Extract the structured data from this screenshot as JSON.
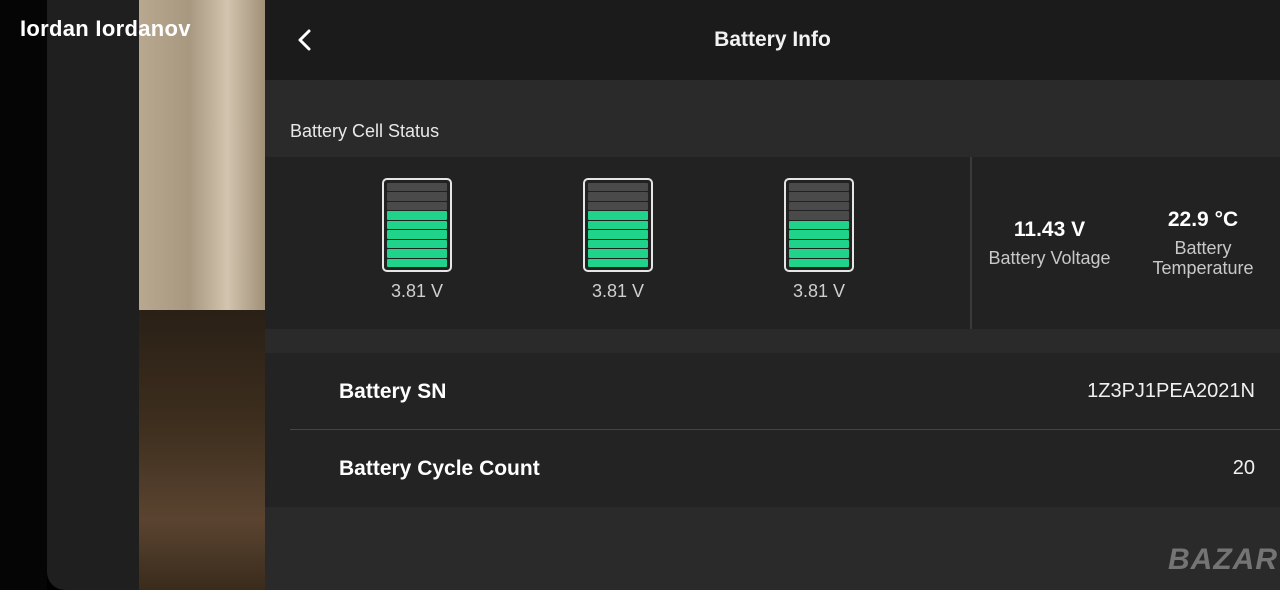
{
  "owner": {
    "name": "Iordan Iordanov"
  },
  "header": {
    "title": "Battery Info"
  },
  "cells": {
    "section_label": "Battery Cell Status",
    "items": [
      {
        "voltage": "3.81 V",
        "level_bars": 6,
        "total_bars": 9
      },
      {
        "voltage": "3.81 V",
        "level_bars": 6,
        "total_bars": 9
      },
      {
        "voltage": "3.81 V",
        "level_bars": 5,
        "total_bars": 9
      }
    ]
  },
  "stats": {
    "voltage": {
      "value": "11.43 V",
      "label": "Battery Voltage"
    },
    "temperature": {
      "value": "22.9 °C",
      "label": "Battery Temperature"
    }
  },
  "info": {
    "sn": {
      "label": "Battery SN",
      "value": "1Z3PJ1PEA2021N"
    },
    "cycle": {
      "label": "Battery Cycle Count",
      "value": "20"
    }
  },
  "watermark": "BAZAR",
  "colors": {
    "accent": "#1fd38a",
    "panel": "#2a2a2a",
    "header": "#1b1b1b"
  }
}
